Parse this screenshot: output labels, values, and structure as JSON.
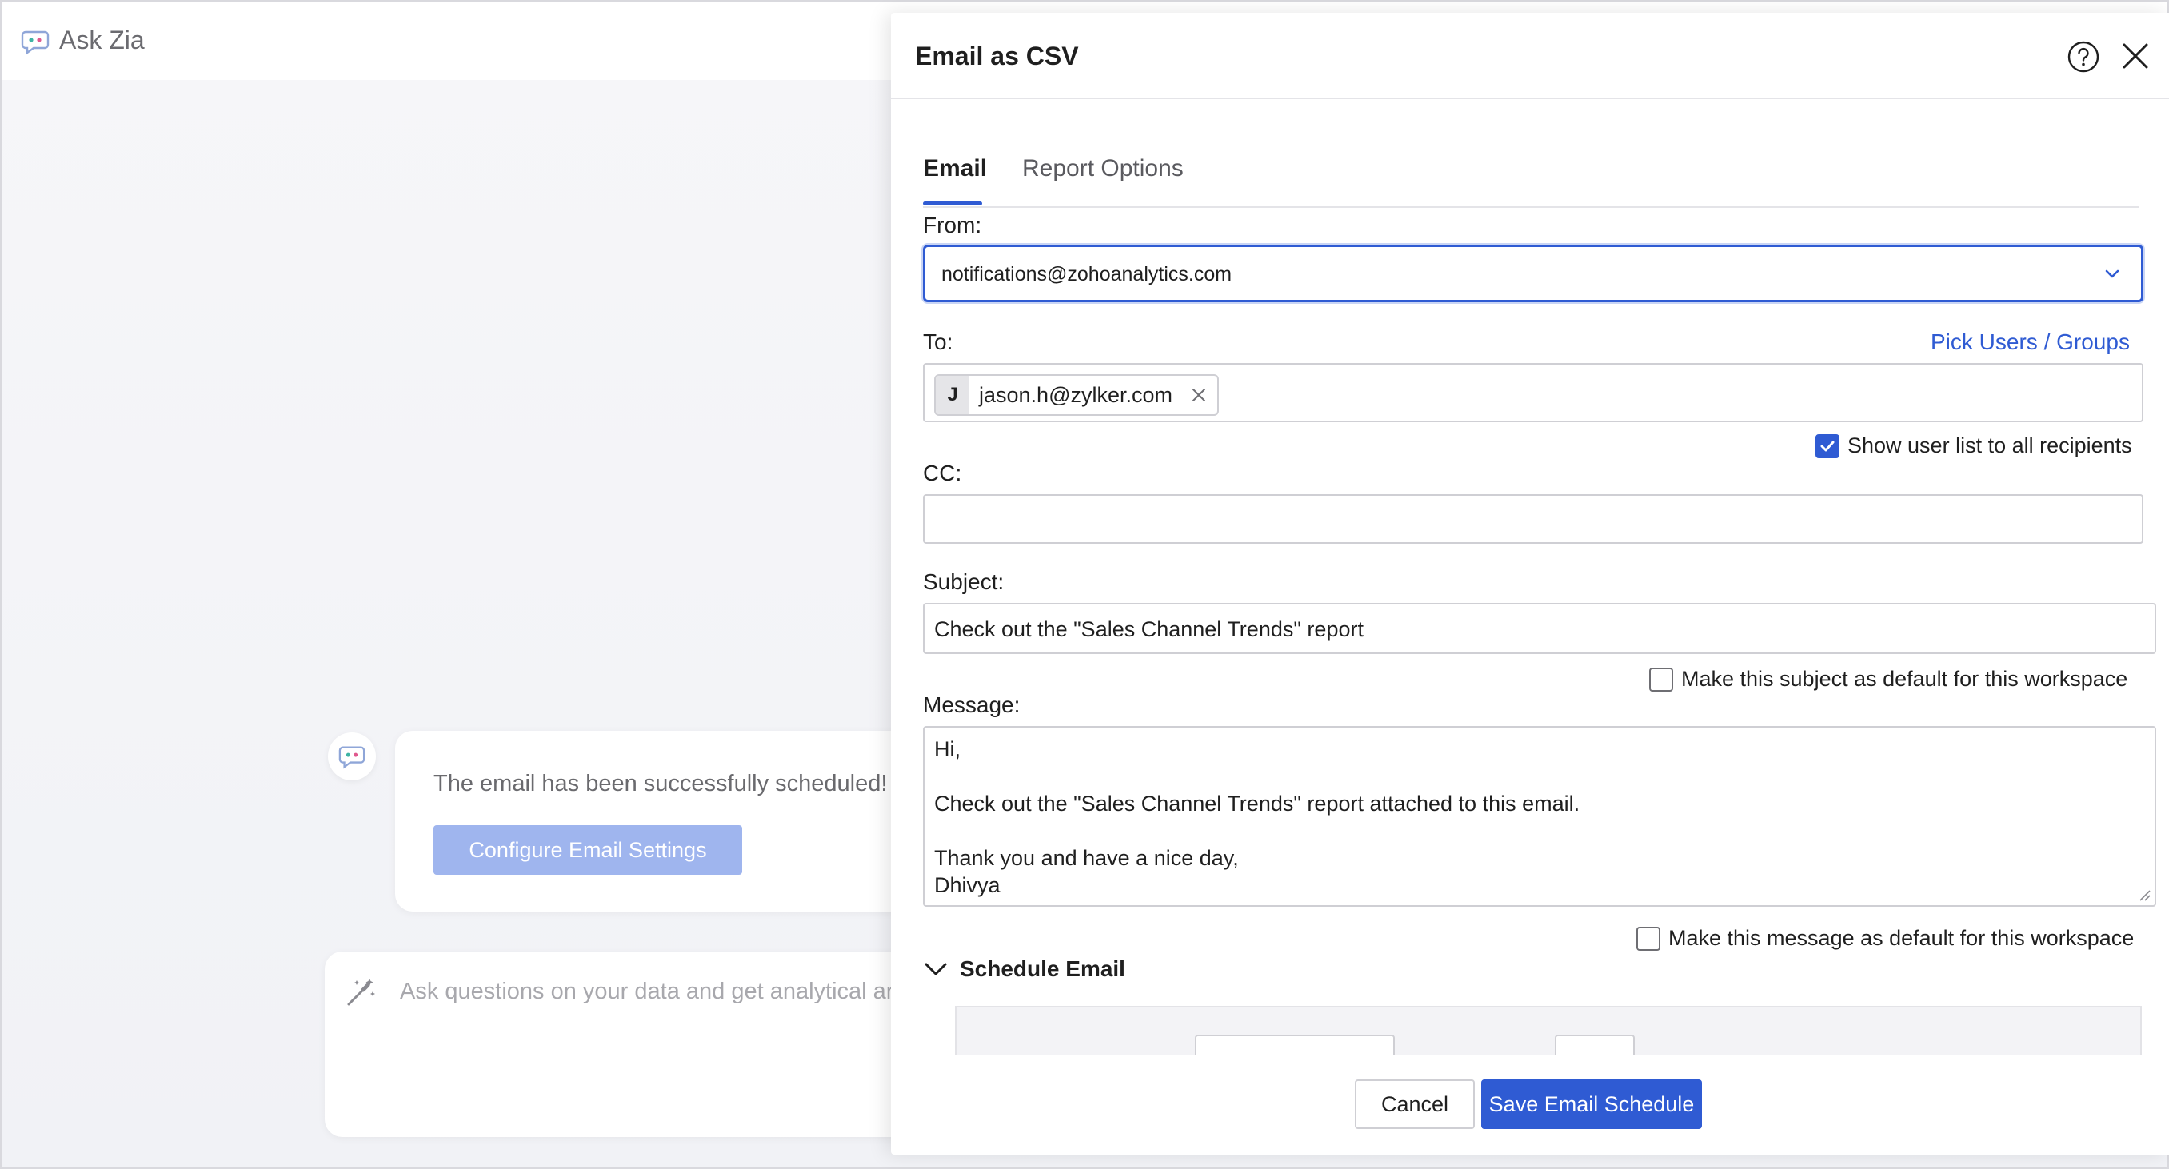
{
  "app": {
    "title": "Ask Zia",
    "chat_message": "The email has been successfully scheduled! I",
    "configure_button": "Configure Email Settings",
    "ask_placeholder": "Ask questions on your data and get analytical ar"
  },
  "dialog": {
    "title": "Email as CSV",
    "tabs": [
      {
        "label": "Email",
        "active": true
      },
      {
        "label": "Report Options",
        "active": false
      }
    ],
    "from": {
      "label": "From:",
      "value": "notifications@zohoanalytics.com"
    },
    "to": {
      "label": "To:",
      "pick_link": "Pick Users / Groups",
      "recipients": [
        {
          "initial": "J",
          "email": "jason.h@zylker.com"
        }
      ],
      "show_user_list": {
        "label": "Show user list to all recipients",
        "checked": true
      }
    },
    "cc": {
      "label": "CC:",
      "value": ""
    },
    "subject": {
      "label": "Subject:",
      "value": "Check out the \"Sales Channel Trends\" report",
      "default_option": {
        "label": "Make this subject as default for this workspace",
        "checked": false
      }
    },
    "message": {
      "label": "Message:",
      "lines": [
        "Hi,",
        "",
        "Check out the \"Sales Channel Trends\" report attached to this email.",
        "",
        "Thank you and have a nice day,",
        "Dhivya"
      ],
      "default_option": {
        "label": "Make this message as default for this workspace",
        "checked": false
      }
    },
    "schedule": {
      "title": "Schedule Email",
      "expanded": true
    },
    "buttons": {
      "cancel": "Cancel",
      "save": "Save Email Schedule"
    }
  },
  "colors": {
    "accent": "#2f5bd3",
    "config_button": "#9fb5ee"
  }
}
